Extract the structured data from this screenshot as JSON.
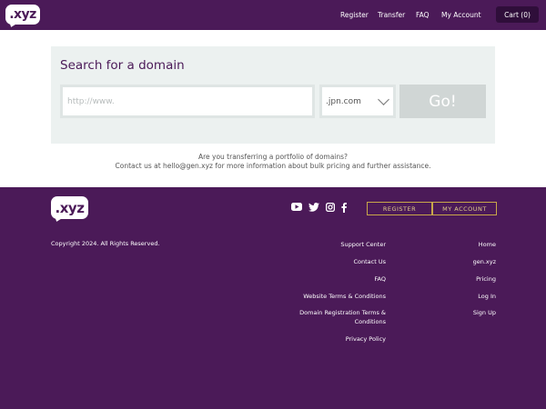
{
  "header": {
    "logo_text": ".xyz",
    "nav": [
      "Register",
      "Transfer",
      "FAQ",
      "My Account"
    ],
    "cart_label": "Cart (0)"
  },
  "search": {
    "title": "Search for a domain",
    "placeholder": "http://www.",
    "tld_selected": ".jpn.com",
    "go_label": "Go!"
  },
  "help": {
    "line1": "Are you transferring a portfolio of domains?",
    "line2": "Contact us at hello@gen.xyz for more information about bulk pricing and further assistance."
  },
  "footer": {
    "logo_text": ".xyz",
    "social_icons": [
      "youtube-icon",
      "twitter-icon",
      "instagram-icon",
      "facebook-icon"
    ],
    "register_label": "REGISTER",
    "account_label": "MY ACCOUNT",
    "copyright": "Copyright 2024. All Rights Reserved.",
    "links_left": [
      "Support Center",
      "Contact Us",
      "FAQ",
      "Website Terms & Conditions",
      "Domain Registration Terms & Conditions",
      "Privacy Policy"
    ],
    "links_right": [
      "Home",
      "gen.xyz",
      "Pricing",
      "Log In",
      "Sign Up"
    ]
  },
  "colors": {
    "brand_purple": "#4b1a58",
    "cart_bg": "#2f0e3a",
    "gold_accent": "#c8a74a",
    "search_panel": "#ecf1f0",
    "go_button": "#d0d6d5"
  }
}
